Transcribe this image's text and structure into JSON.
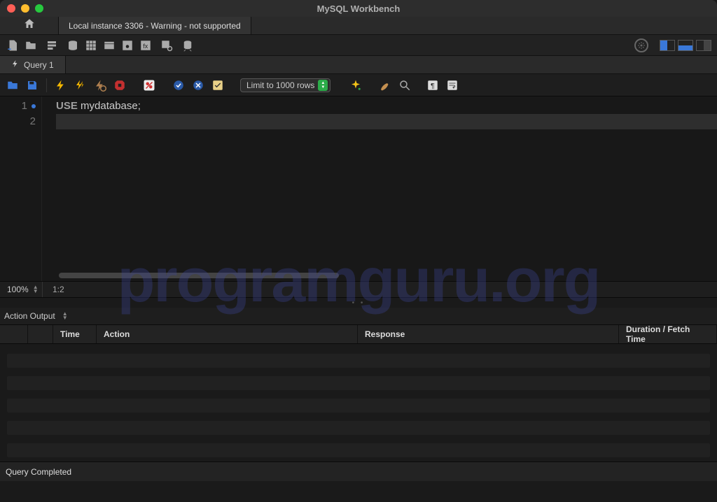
{
  "window": {
    "title": "MySQL Workbench",
    "connection_tab": "Local instance 3306 - Warning - not supported"
  },
  "query_tab": {
    "label": "Query 1"
  },
  "query_toolbar": {
    "limit_label": "Limit to 1000 rows"
  },
  "editor": {
    "lines": {
      "l1_num": "1",
      "l2_num": "2",
      "l1_kw": "USE",
      "l1_ident": " mydatabase",
      "l1_semi": ";"
    },
    "zoom": "100%",
    "cursor_pos": "1:2"
  },
  "output": {
    "panel_label": "Action Output",
    "columns": {
      "time": "Time",
      "action": "Action",
      "response": "Response",
      "duration": "Duration / Fetch Time"
    }
  },
  "status_bar": {
    "message": "Query Completed"
  },
  "watermark": "programguru.org"
}
